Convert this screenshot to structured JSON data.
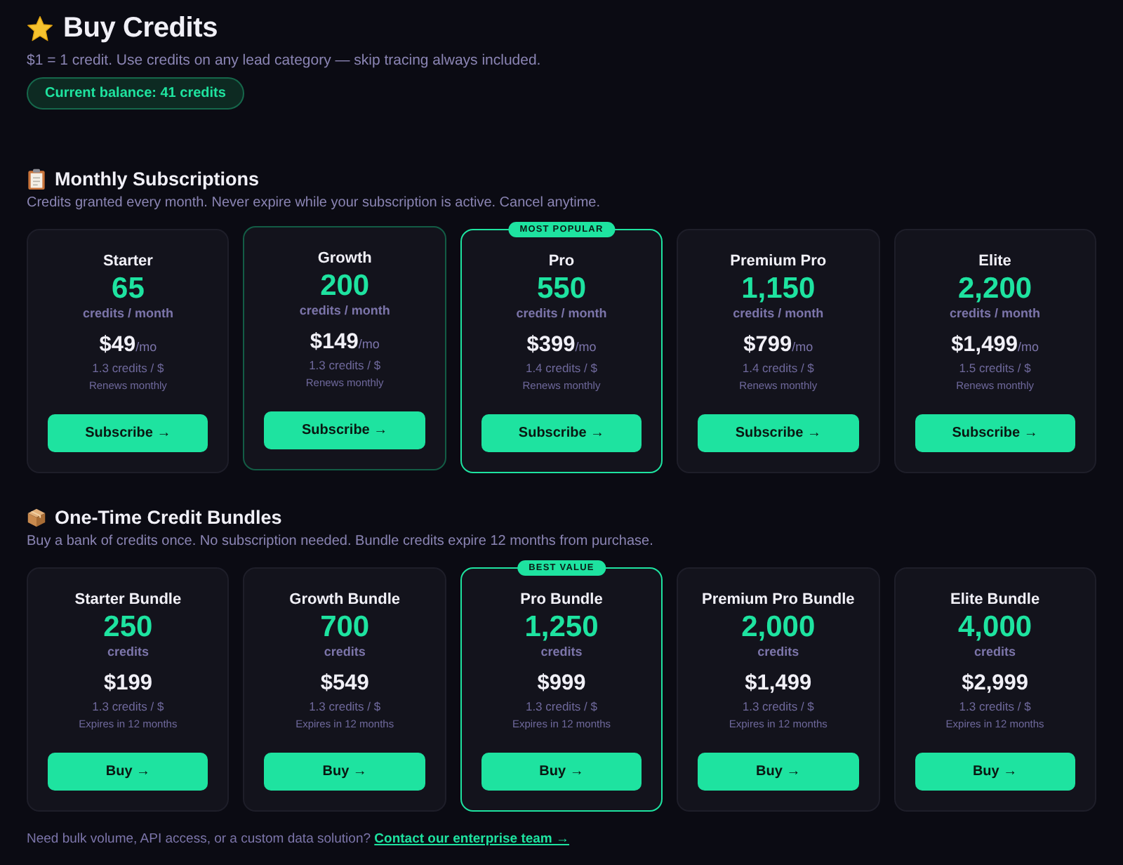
{
  "header": {
    "title": "Buy Credits",
    "subtitle": "$1 = 1 credit. Use credits on any lead category — skip tracing always included.",
    "balance": "Current balance: 41 credits"
  },
  "sections": [
    {
      "kind": "subscriptions",
      "title": "Monthly Subscriptions",
      "description": "Credits granted every month. Never expire while your subscription is active. Cancel anytime.",
      "plans": [
        {
          "name": "Starter",
          "credits": "65",
          "credits_unit": "credits / month",
          "price": "$49",
          "price_unit": "/mo",
          "rate": "1.3 credits / $",
          "term": "Renews monthly",
          "button": "Subscribe →",
          "featured": false,
          "hovered": false
        },
        {
          "name": "Growth",
          "credits": "200",
          "credits_unit": "credits / month",
          "price": "$149",
          "price_unit": "/mo",
          "rate": "1.3 credits / $",
          "term": "Renews monthly",
          "button": "Subscribe →",
          "featured": false,
          "hovered": true
        },
        {
          "name": "Pro",
          "badge": "MOST POPULAR",
          "credits": "550",
          "credits_unit": "credits / month",
          "price": "$399",
          "price_unit": "/mo",
          "rate": "1.4 credits / $",
          "term": "Renews monthly",
          "button": "Subscribe →",
          "featured": true,
          "hovered": false
        },
        {
          "name": "Premium Pro",
          "credits": "1,150",
          "credits_unit": "credits / month",
          "price": "$799",
          "price_unit": "/mo",
          "rate": "1.4 credits / $",
          "term": "Renews monthly",
          "button": "Subscribe →",
          "featured": false,
          "hovered": false
        },
        {
          "name": "Elite",
          "credits": "2,200",
          "credits_unit": "credits / month",
          "price": "$1,499",
          "price_unit": "/mo",
          "rate": "1.5 credits / $",
          "term": "Renews monthly",
          "button": "Subscribe →",
          "featured": false,
          "hovered": false
        }
      ]
    },
    {
      "kind": "bundles",
      "title": "One-Time Credit Bundles",
      "description": "Buy a bank of credits once. No subscription needed. Bundle credits expire 12 months from purchase.",
      "plans": [
        {
          "name": "Starter Bundle",
          "credits": "250",
          "credits_unit": "credits",
          "price": "$199",
          "rate": "1.3 credits / $",
          "term": "Expires in 12 months",
          "button": "Buy →",
          "featured": false,
          "hovered": false
        },
        {
          "name": "Growth Bundle",
          "credits": "700",
          "credits_unit": "credits",
          "price": "$549",
          "rate": "1.3 credits / $",
          "term": "Expires in 12 months",
          "button": "Buy →",
          "featured": false,
          "hovered": false
        },
        {
          "name": "Pro Bundle",
          "badge": "BEST VALUE",
          "credits": "1,250",
          "credits_unit": "credits",
          "price": "$999",
          "rate": "1.3 credits / $",
          "term": "Expires in 12 months",
          "button": "Buy →",
          "featured": true,
          "hovered": false
        },
        {
          "name": "Premium Pro Bundle",
          "credits": "2,000",
          "credits_unit": "credits",
          "price": "$1,499",
          "rate": "1.3 credits / $",
          "term": "Expires in 12 months",
          "button": "Buy →",
          "featured": false,
          "hovered": false
        },
        {
          "name": "Elite Bundle",
          "credits": "4,000",
          "credits_unit": "credits",
          "price": "$2,999",
          "rate": "1.3 credits / $",
          "term": "Expires in 12 months",
          "button": "Buy →",
          "featured": false,
          "hovered": false
        }
      ]
    }
  ],
  "footer": {
    "text": "Need bulk volume, API access, or a custom data solution?",
    "link": "Contact our enterprise team →"
  }
}
